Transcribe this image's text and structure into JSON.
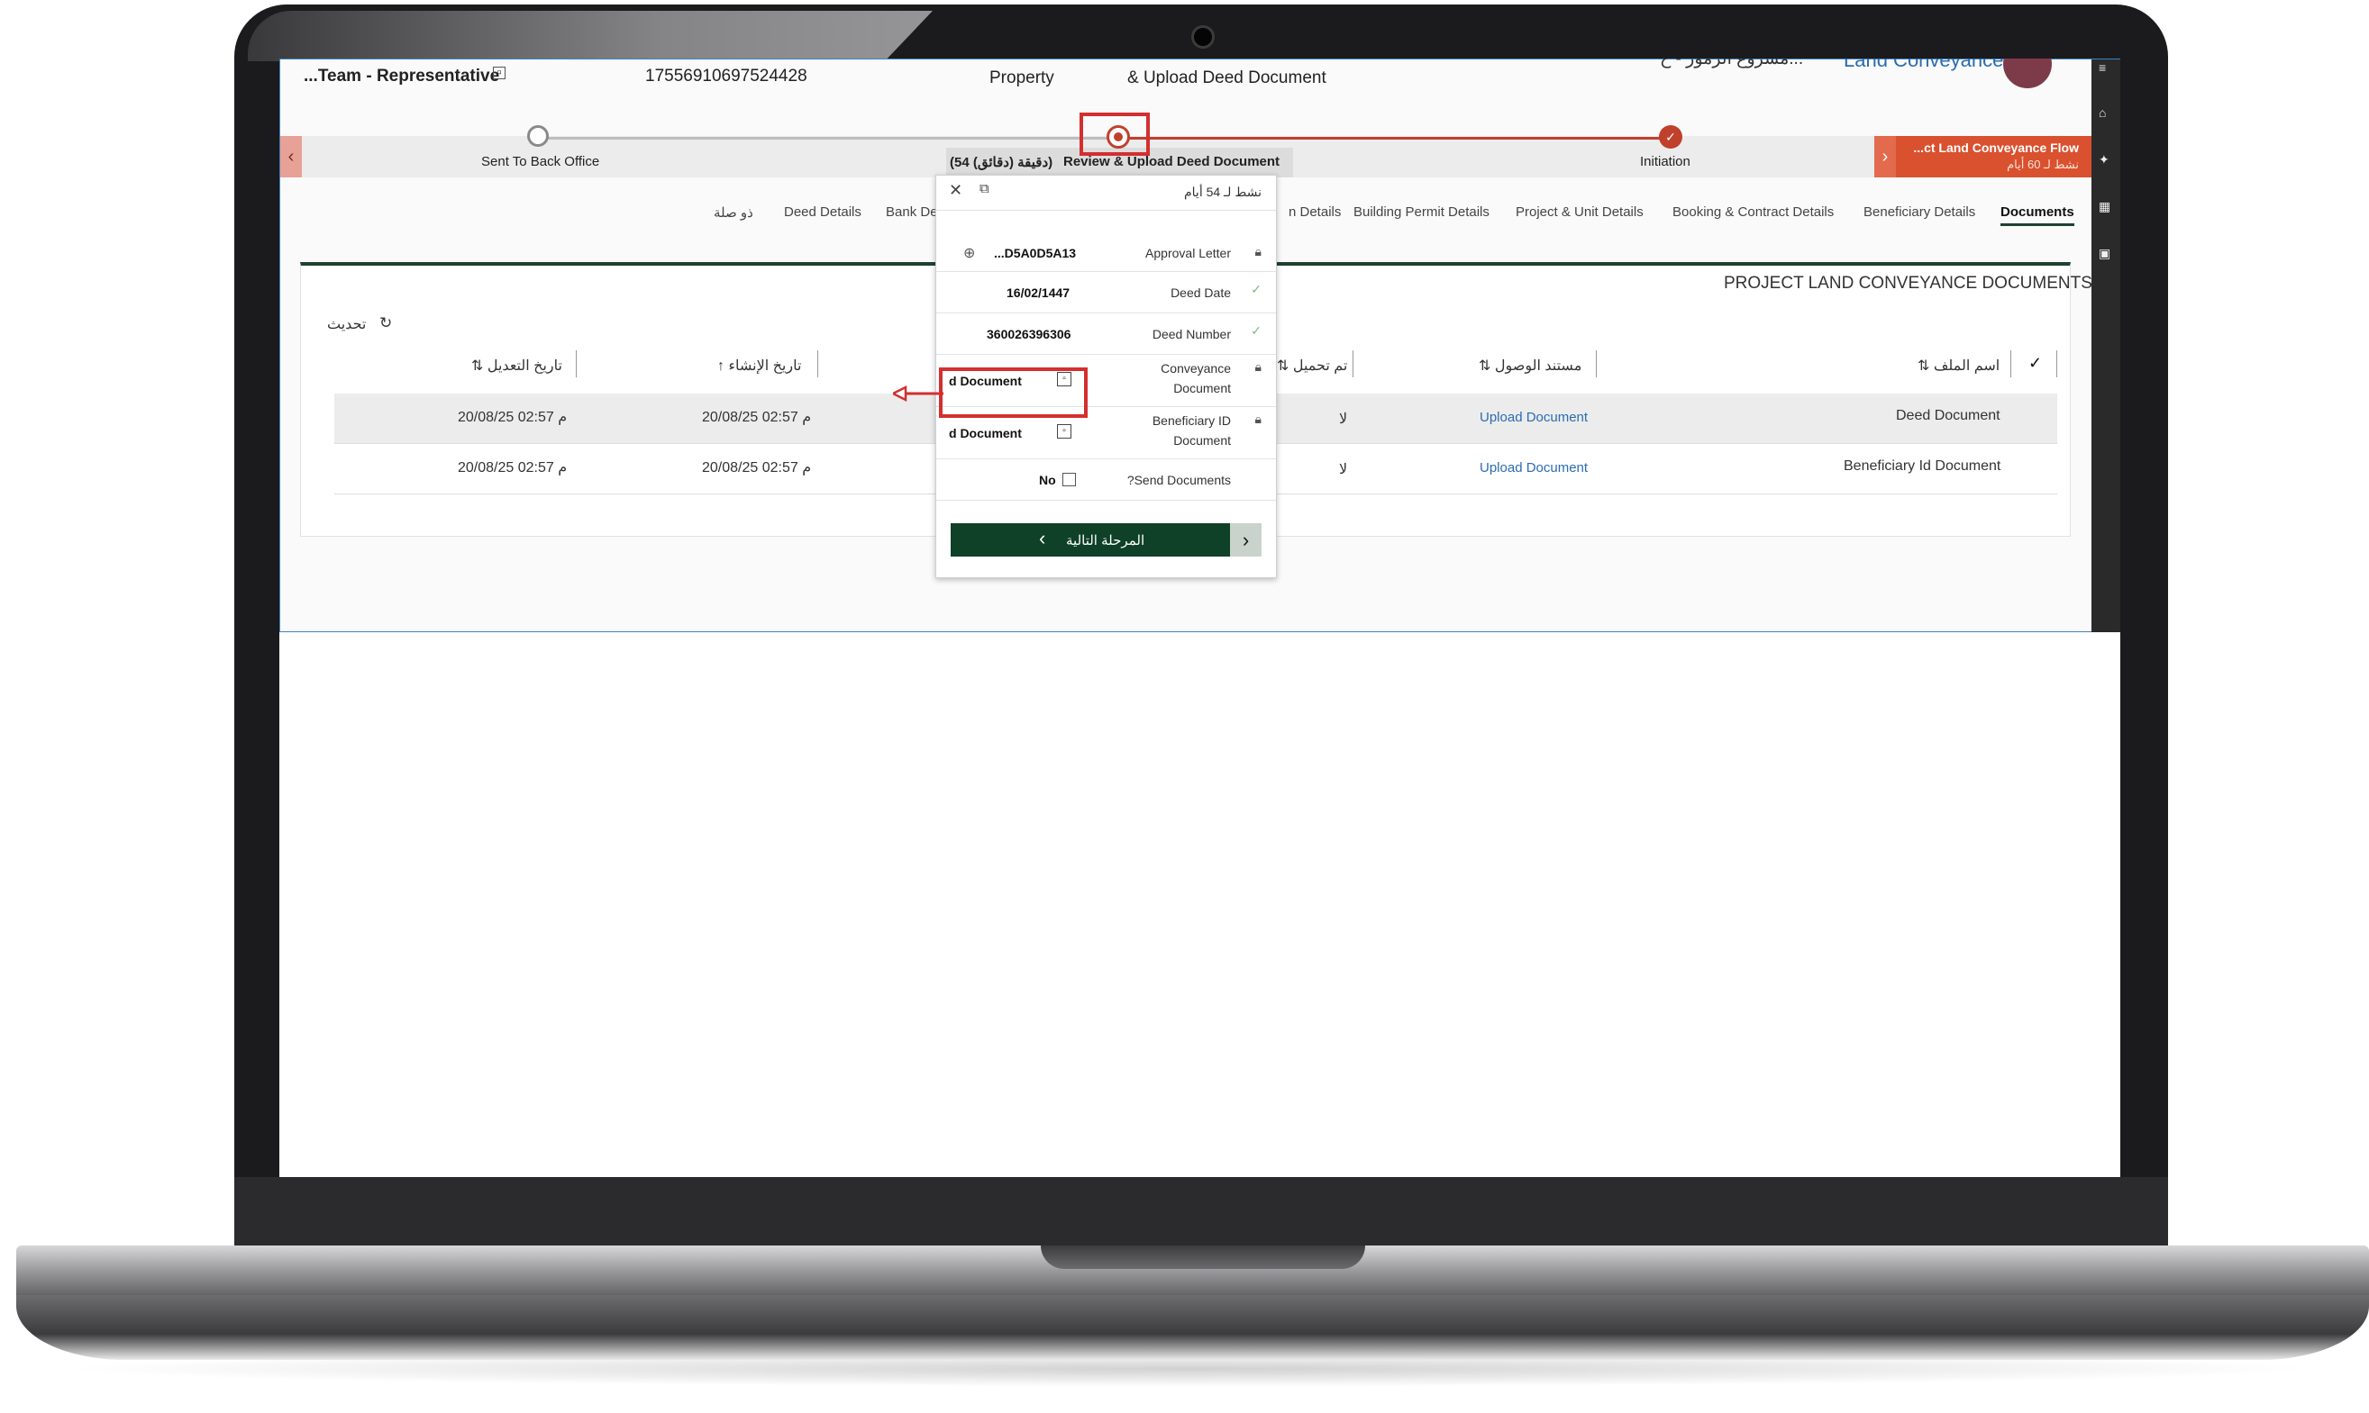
{
  "header": {
    "team": "...Team - Representative",
    "id_number": "17556910697524428",
    "property": "Property",
    "stage_title": "& Upload Deed Document",
    "project_title": "مشروع الرموز - ح...",
    "app_name": "Land Conveyance"
  },
  "stages": {
    "sent_back": "Sent To Back Office",
    "active": "Review & Upload Deed Document",
    "active_duration": "(54 دقيقة (دقائق))",
    "initiation": "Initiation",
    "flow_name": "...ct Land Conveyance Flow",
    "flow_active": "نشط لـ 60 أيام"
  },
  "tabs": {
    "documents": "Documents",
    "beneficiary": "Beneficiary Details",
    "booking": "Booking & Contract Details",
    "project_unit": "Project & Unit Details",
    "building_permit": "Building Permit Details",
    "partial_details": "n Details",
    "bank": "Bank De",
    "deed": "Deed Details",
    "related": "ذو صلة"
  },
  "section": {
    "title": "PROJECT LAND CONVEYANCE DOCUMENTS",
    "refresh": "تحديث"
  },
  "table": {
    "headers": {
      "file_name": "اسم الملف",
      "receipt_doc": "مستند الوصول",
      "uploaded": "تم تحميل",
      "created": "تاريخ الإنشاء",
      "modified": "تاريخ التعديل"
    },
    "rows": [
      {
        "file_name": "Deed Document",
        "action": "Upload Document",
        "uploaded": "لا",
        "created": "20/08/25 02:57 م",
        "modified": "20/08/25 02:57 م"
      },
      {
        "file_name": "Beneficiary Id Document",
        "action": "Upload Document",
        "uploaded": "لا",
        "created": "20/08/25 02:57 م",
        "modified": "20/08/25 02:57 م"
      }
    ]
  },
  "popup": {
    "active_days": "نشط لـ 54 أيام",
    "approval_letter_label": "Approval Letter",
    "approval_letter_value": "...D5A0D5A13",
    "deed_date_label": "Deed Date",
    "deed_date_value": "16/02/1447",
    "deed_number_label": "Deed Number",
    "deed_number_value": "360026396306",
    "conveyance_label_1": "Conveyance",
    "conveyance_label_2": "Document",
    "conveyance_value": "d Document",
    "beneficiary_label_1": "Beneficiary ID",
    "beneficiary_label_2": "Document",
    "beneficiary_value": "d Document",
    "send_label": "?Send Documents",
    "send_value": "No",
    "next_button": "المرحلة التالية"
  },
  "colors": {
    "accent_green": "#0f4028",
    "accent_red": "#c0402c",
    "highlight_red": "#d32f2f",
    "link_blue": "#2b6cb0"
  }
}
